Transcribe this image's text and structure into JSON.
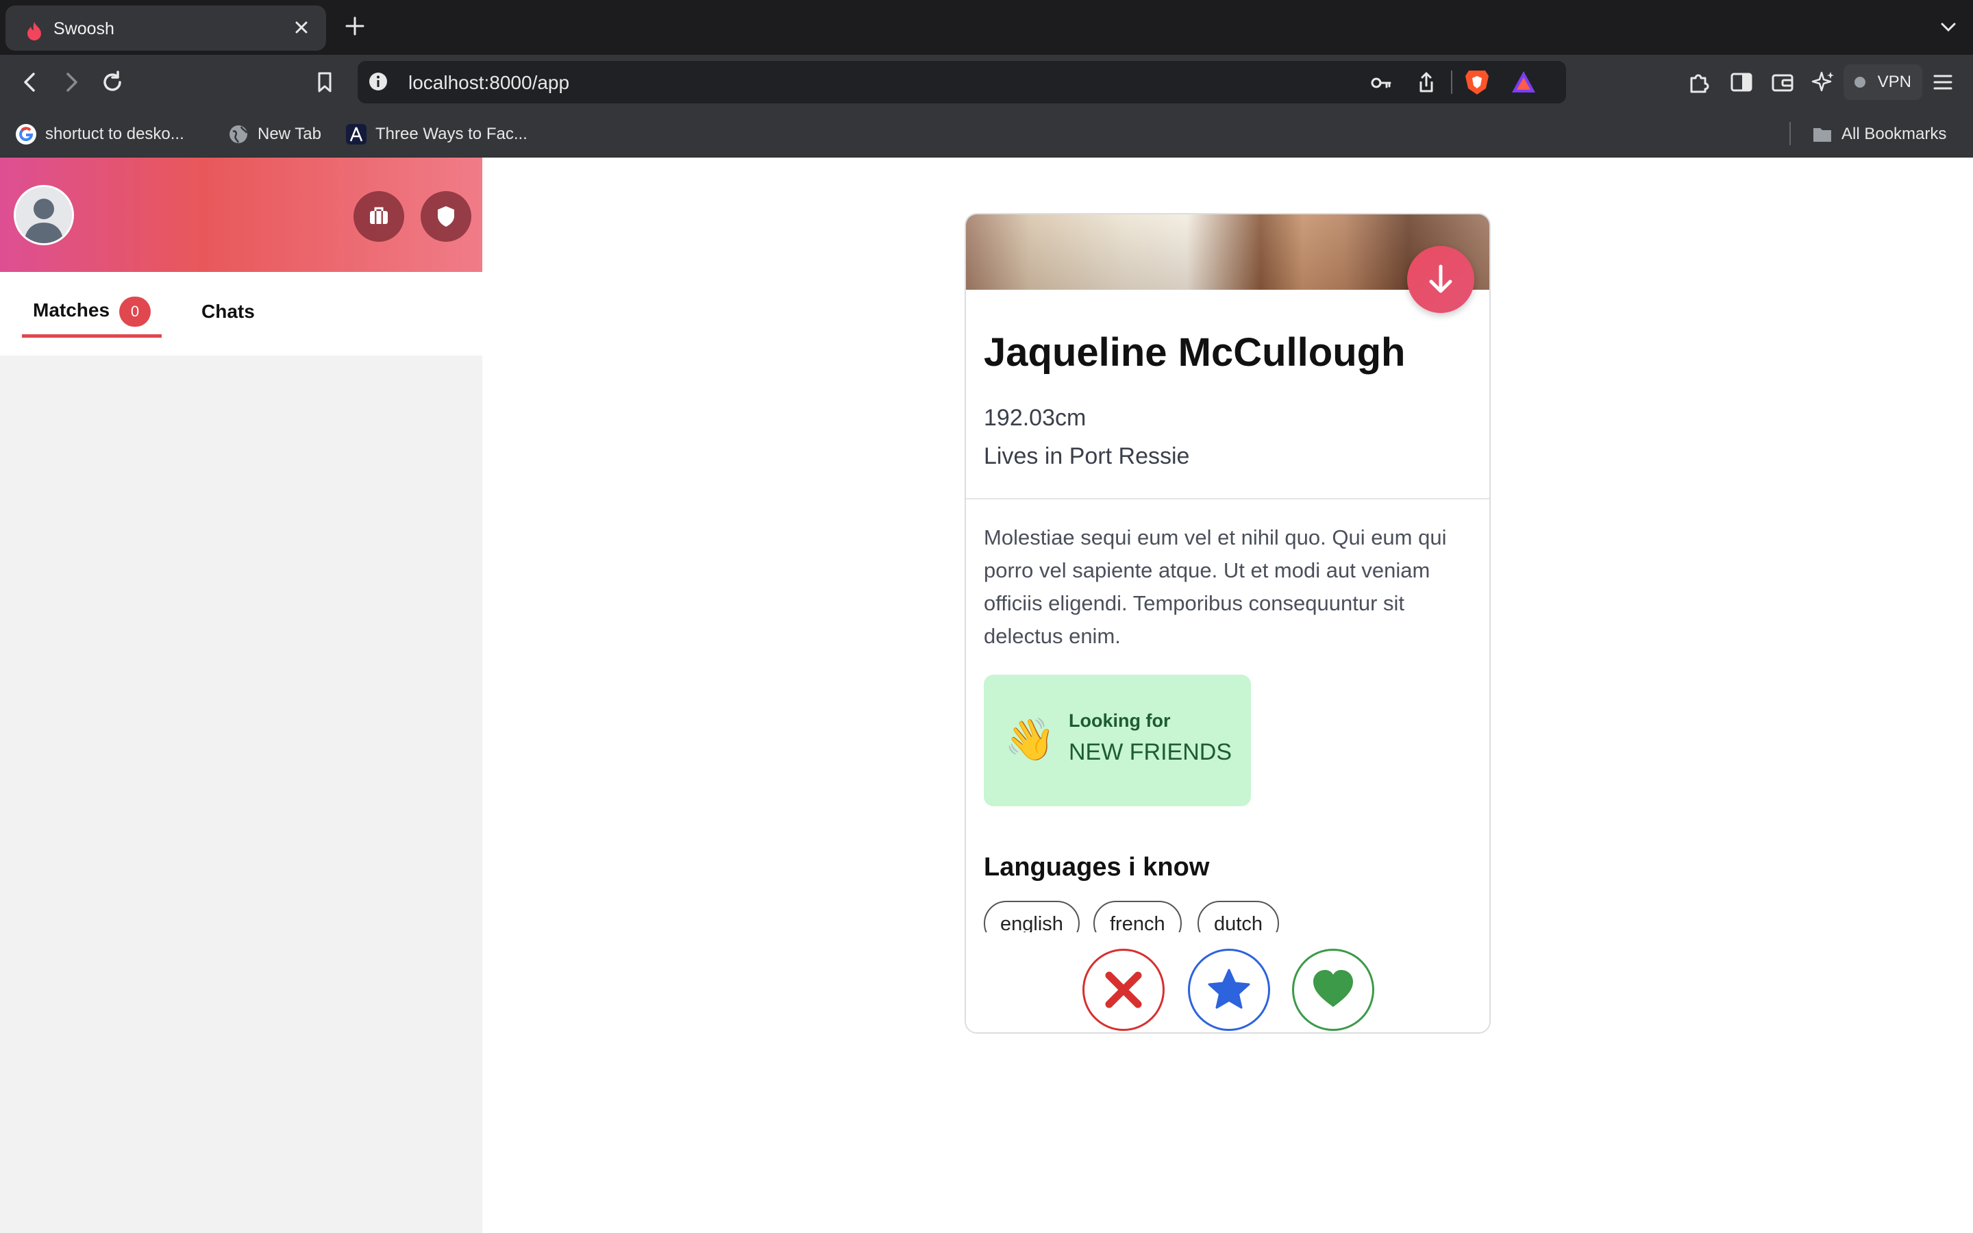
{
  "browser": {
    "tab_title": "Swoosh",
    "url": "localhost:8000/app",
    "vpn_label": "VPN",
    "bookmarks": [
      {
        "label": "shortuct to desko...",
        "icon": "google-icon"
      },
      {
        "label": "New Tab",
        "icon": "globe-icon"
      },
      {
        "label": "Three Ways to Fac...",
        "icon": "angular-icon"
      }
    ],
    "all_bookmarks": "All Bookmarks"
  },
  "sidebar": {
    "tabs": {
      "matches_label": "Matches",
      "matches_count": "0",
      "chats_label": "Chats"
    },
    "header_icons": [
      "briefcase-icon",
      "shield-icon"
    ]
  },
  "profile": {
    "name": "Jaqueline McCullough",
    "height": "192.03cm",
    "location": "Lives in Port Ressie",
    "bio": "Molestiae sequi eum vel et nihil quo. Qui eum qui porro vel sapiente atque. Ut et modi aut veniam officiis eligendi. Temporibus consequuntur sit delectus enim.",
    "looking_for": {
      "label": "Looking for",
      "value": "NEW FRIENDS",
      "emoji": "👋"
    },
    "languages_title": "Languages i know",
    "languages": [
      "english",
      "french",
      "dutch"
    ]
  },
  "actions": [
    {
      "name": "dislike-button",
      "icon": "x-icon",
      "color": "#d6312f"
    },
    {
      "name": "superlike-button",
      "icon": "star-icon",
      "color": "#2d63dd"
    },
    {
      "name": "like-button",
      "icon": "heart-icon",
      "color": "#3c9a48"
    }
  ],
  "colors": {
    "accent": "#e0474f",
    "looking_bg": "#c8f5d2",
    "sidebar_bg": "#f2f2f3"
  }
}
